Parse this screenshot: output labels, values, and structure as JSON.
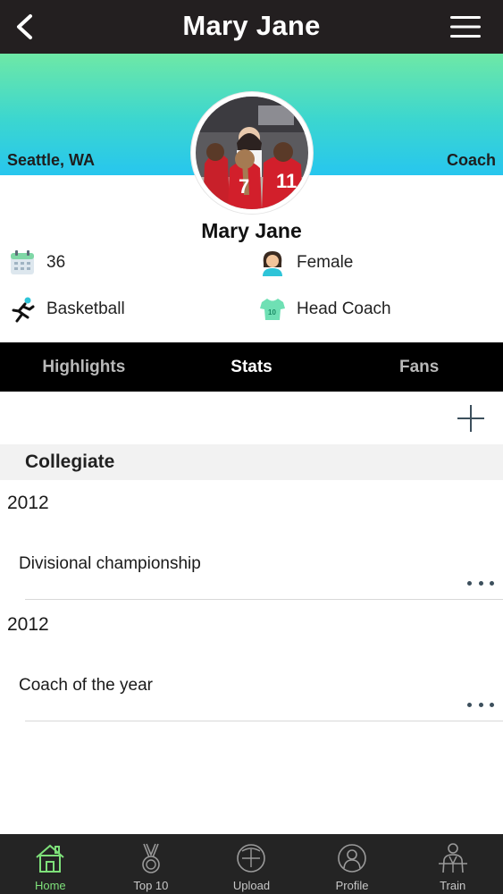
{
  "header": {
    "title": "Mary Jane",
    "back_icon": "chevron-left-icon",
    "menu_icon": "hamburger-menu-icon"
  },
  "banner": {
    "location": "Seattle, WA",
    "role": "Coach",
    "gradient": [
      "#6ee8a6",
      "#27c6ee"
    ]
  },
  "profile": {
    "name": "Mary Jane",
    "info": [
      {
        "icon": "calendar-icon",
        "value": "36"
      },
      {
        "icon": "female-person-icon",
        "value": "Female"
      },
      {
        "icon": "runner-icon",
        "value": "Basketball"
      },
      {
        "icon": "jersey-icon",
        "value": "Head Coach"
      }
    ]
  },
  "tabs": [
    {
      "label": "Highlights",
      "active": false
    },
    {
      "label": "Stats",
      "active": true
    },
    {
      "label": "Fans",
      "active": false
    }
  ],
  "stats": {
    "add_icon": "plus-icon",
    "section": "Collegiate",
    "items": [
      {
        "year": "2012",
        "title": "Divisional championship"
      },
      {
        "year": "2012",
        "title": "Coach of the year"
      }
    ]
  },
  "bottom_nav": [
    {
      "label": "Home",
      "icon": "home-icon",
      "active": true
    },
    {
      "label": "Top 10",
      "icon": "medal-icon",
      "active": false
    },
    {
      "label": "Upload",
      "icon": "upload-icon",
      "active": false
    },
    {
      "label": "Profile",
      "icon": "profile-icon",
      "active": false
    },
    {
      "label": "Train",
      "icon": "trainer-icon",
      "active": false
    }
  ],
  "colors": {
    "topbar": "#231f20",
    "tabs_bg": "#000000",
    "bottom_bg": "#242424",
    "active_green": "#7ee07a"
  }
}
